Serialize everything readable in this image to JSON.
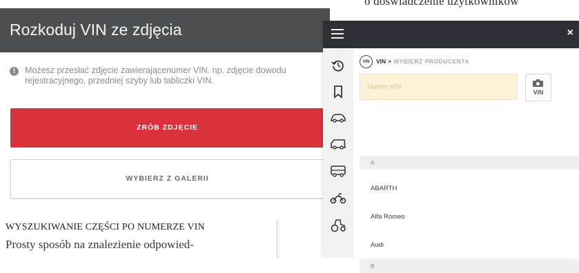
{
  "magazine": {
    "top_text": "o doświadczenie użytkowników",
    "article_heading": "WYSZUKIWANIE CZĘŚCI PO NUMERZE VIN",
    "article_body": "Prosty sposób na znalezienie odpowied-"
  },
  "left_app": {
    "title": "Rozkoduj VIN ze zdjęcia",
    "info_text": "Możesz przesłać zdjęcie zawierającenumer VIN. np. zdjęcie dowodu rejestracyjnego, przedniej szyby lub tabliczki VIN.",
    "take_photo_label": "ZRÓB ZDJĘCIE",
    "gallery_label": "WYBIERZ Z GALERII",
    "colors": {
      "header": "#4d4e50",
      "primary": "#d9323d"
    }
  },
  "right_app": {
    "close_label": "×",
    "breadcrumb": {
      "vin_badge": "VIN",
      "current": "VIN",
      "separator": ">",
      "next": "WYBIERZ PRODUCENTA"
    },
    "vin_input": {
      "placeholder": "Numer VIN",
      "value": ""
    },
    "vin_scan_label": "VIN",
    "sidebar_icons": [
      "history-icon",
      "bookmark-icon",
      "car-icon",
      "van-icon",
      "bus-icon",
      "motorcycle-icon",
      "tractor-icon"
    ],
    "list": {
      "section_a": "A",
      "items": [
        "ABARTH",
        "Alfa Romeo",
        "Audi"
      ],
      "section_b": "B"
    },
    "colors": {
      "topbar": "#2d3035",
      "input_bg": "#fbf2d8"
    }
  }
}
